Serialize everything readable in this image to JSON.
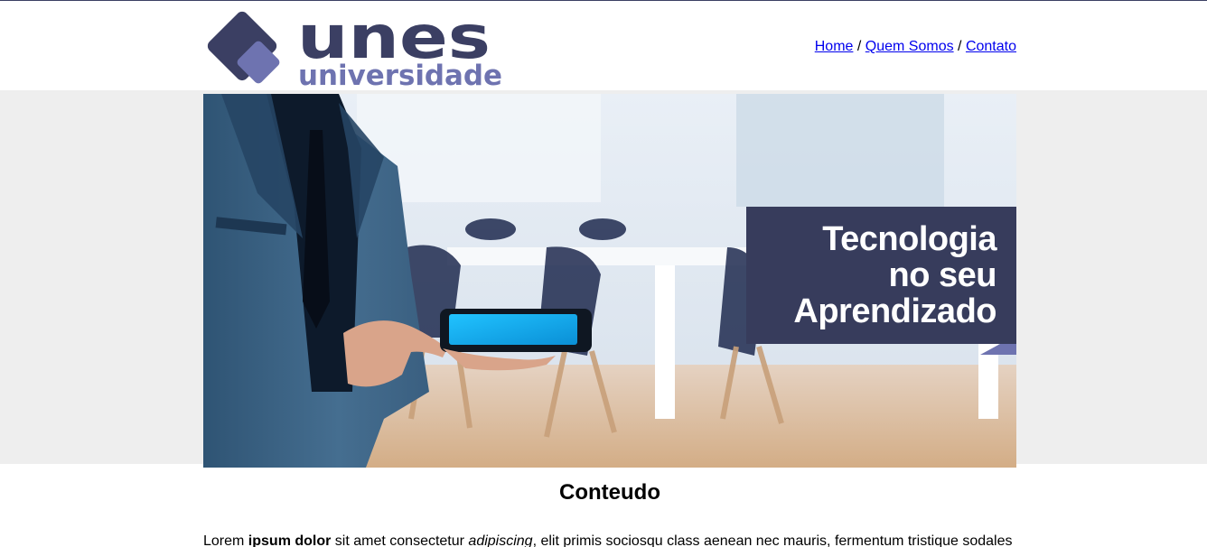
{
  "brand": {
    "name": "unes",
    "subtitle": "universidade",
    "colors": {
      "dark": "#3b3f63",
      "light": "#6e73b0"
    }
  },
  "nav": {
    "items": [
      {
        "label": "Home"
      },
      {
        "label": "Quem Somos"
      },
      {
        "label": "Contato"
      }
    ],
    "separator": "/"
  },
  "hero": {
    "caption_lines": [
      "Tecnologia",
      "no seu",
      "Aprendizado"
    ]
  },
  "content": {
    "title": "Conteudo",
    "paragraph": {
      "t1": "Lorem ",
      "bold": "ipsum dolor",
      "t2": " sit amet consectetur ",
      "italic": "adipiscing",
      "t3": ", elit primis sociosqu class aenean nec mauris, fermentum tristique sodales"
    }
  }
}
